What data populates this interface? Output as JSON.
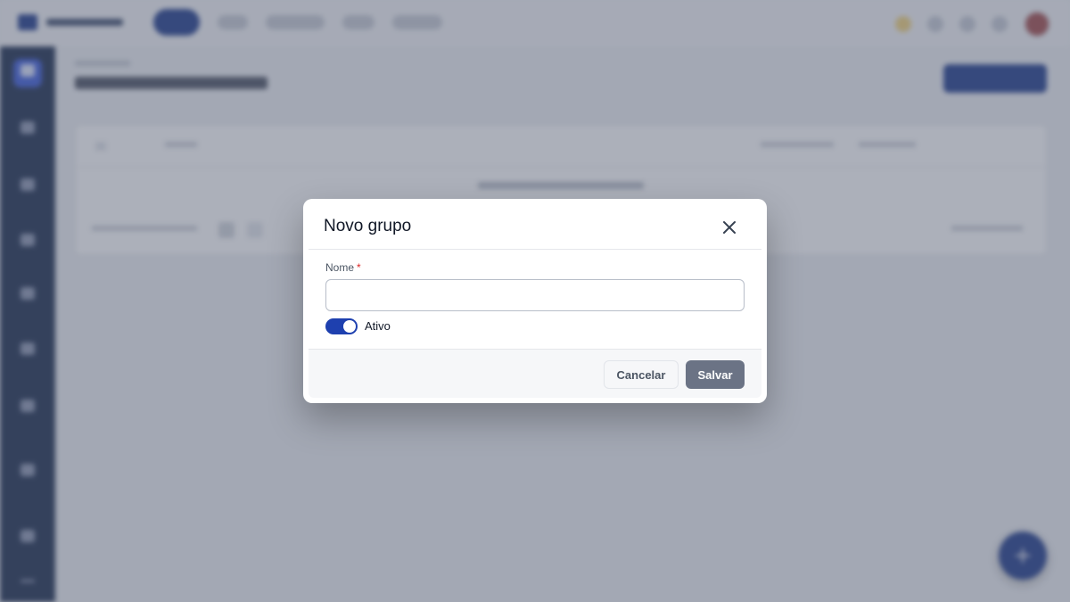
{
  "modal": {
    "title": "Novo grupo",
    "close_icon": "close-icon",
    "name_label": "Nome",
    "required_mark": "*",
    "name_value": "",
    "name_placeholder": "",
    "active_toggle": {
      "label": "Ativo",
      "checked": true
    },
    "cancel_label": "Cancelar",
    "save_label": "Salvar",
    "colors": {
      "toggle_on": "#1e40af",
      "save_disabled": "#6b7385",
      "required": "#dc2626"
    }
  },
  "background": {
    "overlay_color": "rgba(82, 90, 110, 0.48)",
    "brand_color": "#1e3a8a",
    "sidebar_color": "#1a2b4c"
  }
}
